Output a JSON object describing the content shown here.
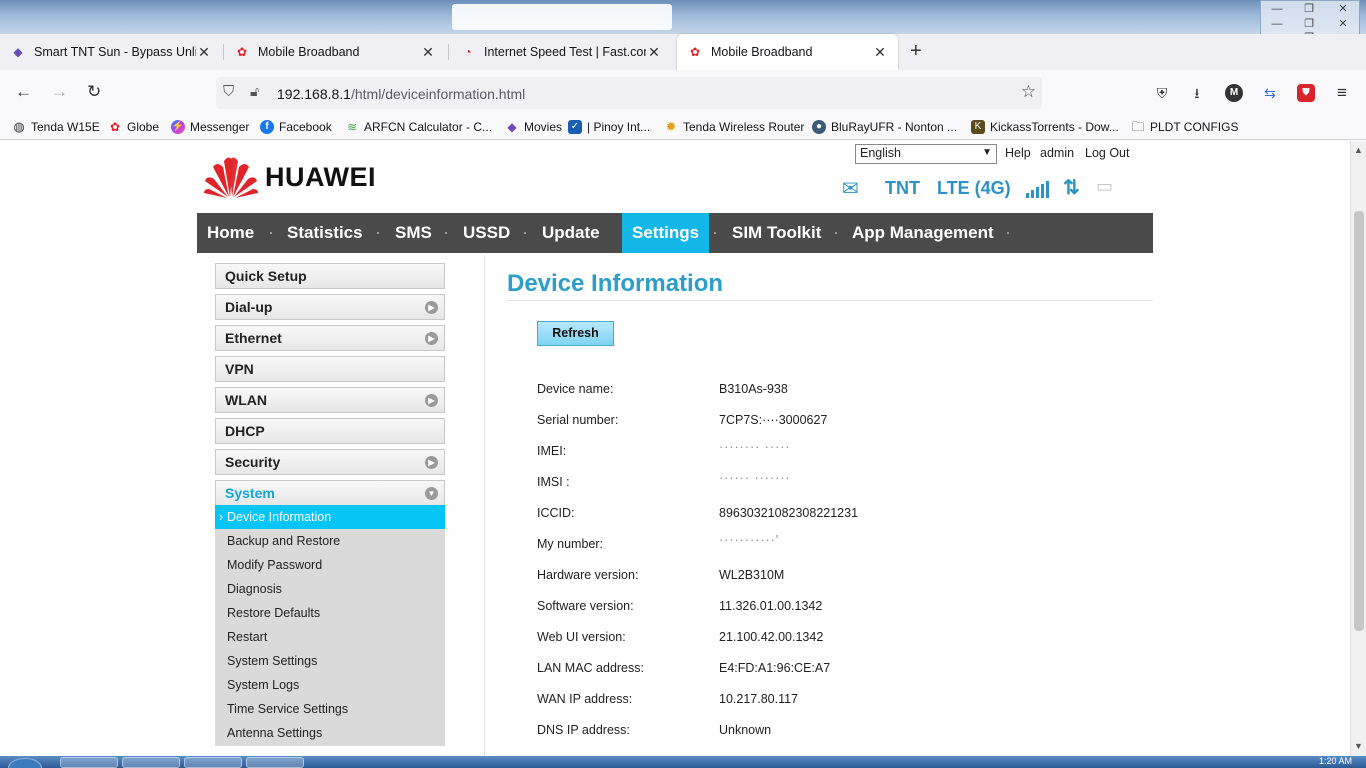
{
  "browser": {
    "tabs": [
      {
        "label": "Smart TNT Sun - Bypass Unlida",
        "favicon": "shield-logo-icon",
        "active": false
      },
      {
        "label": "Mobile Broadband",
        "favicon": "huawei-icon",
        "active": false
      },
      {
        "label": "Internet Speed Test | Fast.com",
        "favicon": "speedometer-icon",
        "active": false
      },
      {
        "label": "Mobile Broadband",
        "favicon": "huawei-icon",
        "active": true
      }
    ],
    "url_host": "192.168.8.1",
    "url_path": "/html/deviceinformation.html",
    "bookmarks": [
      {
        "label": "Tenda W15E",
        "icon": "globe-icon"
      },
      {
        "label": "Globe",
        "icon": "huawei-icon"
      },
      {
        "label": "Messenger",
        "icon": "messenger-icon"
      },
      {
        "label": "Facebook",
        "icon": "facebook-icon"
      },
      {
        "label": "ARFCN Calculator - C...",
        "icon": "signal-icon"
      },
      {
        "label": "Movies",
        "icon": "shield-logo-icon"
      },
      {
        "label": "| Pinoy Int...",
        "icon": "checkbox-icon"
      },
      {
        "label": "Tenda Wireless Router",
        "icon": "gear-icon"
      },
      {
        "label": "BluRayUFR - Nonton ...",
        "icon": "disc-icon"
      },
      {
        "label": "KickassTorrents - Dow...",
        "icon": "kat-icon"
      },
      {
        "label": "PLDT CONFIGS",
        "icon": "folder-icon"
      }
    ]
  },
  "router": {
    "brand": "HUAWEI",
    "language": "English",
    "top_links": {
      "help": "Help",
      "user": "admin",
      "logout": "Log Out"
    },
    "status": {
      "operator": "TNT",
      "network": "LTE (4G)"
    },
    "nav": [
      "Home",
      "Statistics",
      "SMS",
      "USSD",
      "Update",
      "Settings",
      "SIM Toolkit",
      "App Management"
    ],
    "nav_active": "Settings",
    "sidebar": [
      {
        "label": "Quick Setup",
        "expandable": false
      },
      {
        "label": "Dial-up",
        "expandable": true
      },
      {
        "label": "Ethernet",
        "expandable": true
      },
      {
        "label": "VPN",
        "expandable": false
      },
      {
        "label": "WLAN",
        "expandable": true
      },
      {
        "label": "DHCP",
        "expandable": false
      },
      {
        "label": "Security",
        "expandable": true
      },
      {
        "label": "System",
        "expandable": true,
        "open": true
      }
    ],
    "system_submenu": [
      "Device Information",
      "Backup and Restore",
      "Modify Password",
      "Diagnosis",
      "Restore Defaults",
      "Restart",
      "System Settings",
      "System Logs",
      "Time Service Settings",
      "Antenna Settings"
    ],
    "content": {
      "title": "Device Information",
      "refresh_label": "Refresh",
      "rows": [
        {
          "label": "Device name:",
          "value": "B310As-938"
        },
        {
          "label": "Serial number:",
          "value": "7CP7S:····3000627"
        },
        {
          "label": "IMEI:",
          "value": "········ ·····"
        },
        {
          "label": "IMSI :",
          "value": "······ ·······"
        },
        {
          "label": "ICCID:",
          "value": "89630321082308221231"
        },
        {
          "label": "My number:",
          "value": "···········'"
        },
        {
          "label": "Hardware version:",
          "value": "WL2B310M"
        },
        {
          "label": "Software version:",
          "value": "11.326.01.00.1342"
        },
        {
          "label": "Web UI version:",
          "value": "21.100.42.00.1342"
        },
        {
          "label": "LAN MAC address:",
          "value": "E4:FD:A1:96:CE:A7"
        },
        {
          "label": "WAN IP address:",
          "value": "10.217.80.117"
        },
        {
          "label": "DNS IP address:",
          "value": "Unknown"
        }
      ]
    }
  },
  "colors": {
    "accent": "#12b7e8",
    "title": "#2c9ec9",
    "nav_bg": "#4a4a4a",
    "brand_red": "#e0242a"
  },
  "taskbar": {
    "clock": "1:20 AM"
  }
}
